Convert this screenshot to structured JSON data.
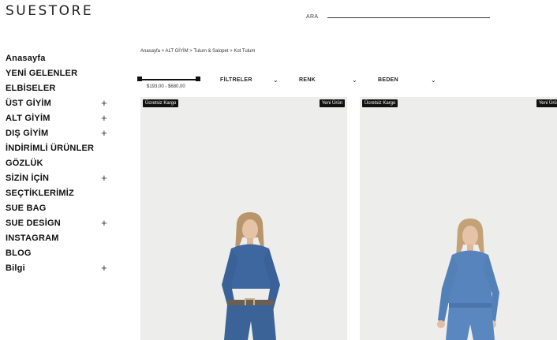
{
  "header": {
    "logo": "SUESTORE",
    "search_label": "ARA"
  },
  "sidebar": {
    "items": [
      {
        "label": "Anasayfa",
        "expand": false
      },
      {
        "label": "YENİ GELENLER",
        "expand": false
      },
      {
        "label": "ELBİSELER",
        "expand": false
      },
      {
        "label": "ÜST GİYİM",
        "expand": true
      },
      {
        "label": "ALT GİYİM",
        "expand": true
      },
      {
        "label": "DIŞ GİYİM",
        "expand": true
      },
      {
        "label": "İNDİRİMLİ ÜRÜNLER",
        "expand": false
      },
      {
        "label": "GÖZLÜK",
        "expand": false
      },
      {
        "label": "SİZİN İÇİN",
        "expand": true
      },
      {
        "label": "SEÇTİKLERİMİZ",
        "expand": false
      },
      {
        "label": "SUE BAG",
        "expand": false
      },
      {
        "label": "SUE DESİGN",
        "expand": true
      },
      {
        "label": "INSTAGRAM",
        "expand": false
      },
      {
        "label": "BLOG",
        "expand": false
      },
      {
        "label": "Bilgi",
        "expand": true
      }
    ],
    "expand_icon": "plus-icon",
    "expand_glyph": "+"
  },
  "breadcrumb": "Anasayfa > ALT GİYİM > Tulum & Salopet > Kot Tulum",
  "filters": {
    "price_range": "$193,00 - $680,00",
    "filtreler": "FİLTRELER",
    "renk": "RENK",
    "beden": "BEDEN",
    "chevron_icon": "chevron-down-icon",
    "chevron_glyph": "⌄"
  },
  "products": [
    {
      "badge_left": "Ücretsiz Kargo",
      "badge_right": "Yeni Ürün"
    },
    {
      "badge_left": "Ücretsiz Kargo",
      "badge_right": "Yeni Ürün"
    }
  ],
  "colors": {
    "accent": "#111111",
    "photo_bg": "#ededeb",
    "denim": "#3f6aa0"
  }
}
